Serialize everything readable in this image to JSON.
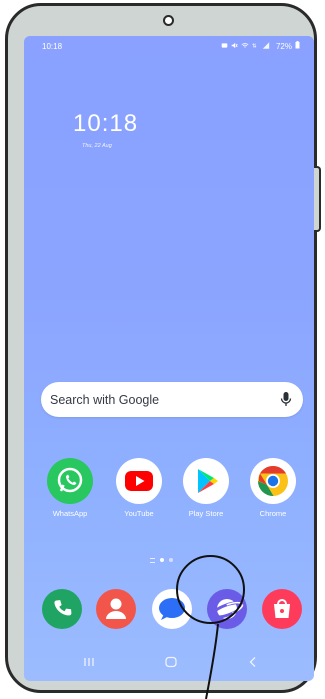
{
  "status_bar": {
    "time": "10:18",
    "battery": "72%"
  },
  "lock_clock": {
    "time": "10:18",
    "date": "Thu, 22 Aug"
  },
  "search": {
    "placeholder": "Search with Google"
  },
  "apps": [
    {
      "label": "WhatsApp",
      "icon": "whatsapp-icon"
    },
    {
      "label": "YouTube",
      "icon": "youtube-icon"
    },
    {
      "label": "Play Store",
      "icon": "play-store-icon"
    },
    {
      "label": "Chrome",
      "icon": "chrome-icon"
    }
  ],
  "dock": [
    {
      "icon": "phone-icon"
    },
    {
      "icon": "contacts-icon"
    },
    {
      "icon": "messages-icon"
    },
    {
      "icon": "internet-icon"
    },
    {
      "icon": "galaxy-store-icon"
    }
  ],
  "nav": {
    "recents_icon": "recents-icon",
    "home_icon": "home-icon",
    "back_icon": "back-icon"
  },
  "colors": {
    "wallpaper_top": "#8aa1ff",
    "wallpaper_bottom": "#9cbcff",
    "frame": "#cfd5d3"
  }
}
